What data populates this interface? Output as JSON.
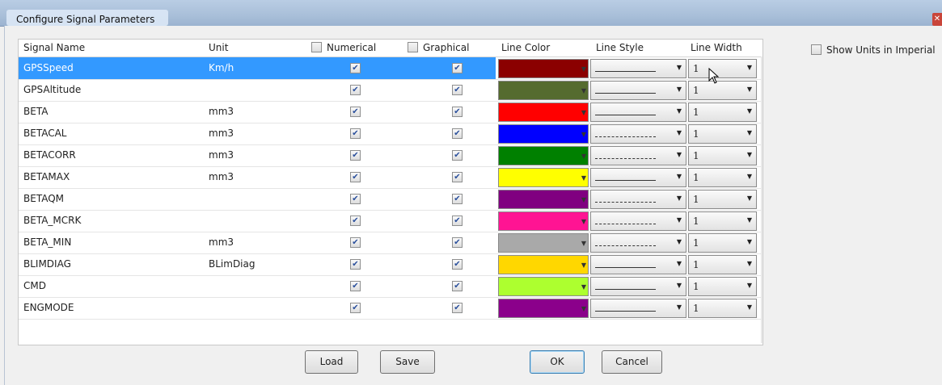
{
  "window": {
    "title": "Configure Signal Parameters",
    "close_icon": "close-icon"
  },
  "grid": {
    "headers": {
      "signal_name": "Signal Name",
      "unit": "Unit",
      "numerical": "Numerical",
      "graphical": "Graphical",
      "line_color": "Line Color",
      "line_style": "Line Style",
      "line_width": "Line Width"
    },
    "rows": [
      {
        "name": "GPSSpeed",
        "unit": "Km/h",
        "numerical": true,
        "graphical": true,
        "color": "#8b0000",
        "style": "solid",
        "width": "1",
        "selected": true
      },
      {
        "name": "GPSAltitude",
        "unit": "",
        "numerical": true,
        "graphical": true,
        "color": "#556b2f",
        "style": "solid",
        "width": "1"
      },
      {
        "name": "BETA",
        "unit": "mm3",
        "numerical": true,
        "graphical": true,
        "color": "#ff0000",
        "style": "solid",
        "width": "1"
      },
      {
        "name": "BETACAL",
        "unit": "mm3",
        "numerical": true,
        "graphical": true,
        "color": "#0000ff",
        "style": "dashed",
        "width": "1"
      },
      {
        "name": "BETACORR",
        "unit": "mm3",
        "numerical": true,
        "graphical": true,
        "color": "#008000",
        "style": "dashed",
        "width": "1"
      },
      {
        "name": "BETAMAX",
        "unit": "mm3",
        "numerical": true,
        "graphical": true,
        "color": "#ffff00",
        "style": "solid",
        "width": "1"
      },
      {
        "name": "BETAQM",
        "unit": "",
        "numerical": true,
        "graphical": true,
        "color": "#800080",
        "style": "dashed",
        "width": "1"
      },
      {
        "name": "BETA_MCRK",
        "unit": "",
        "numerical": true,
        "graphical": true,
        "color": "#ff1493",
        "style": "dashed",
        "width": "1"
      },
      {
        "name": "BETA_MIN",
        "unit": "mm3",
        "numerical": true,
        "graphical": true,
        "color": "#a9a9a9",
        "style": "dashed",
        "width": "1"
      },
      {
        "name": "BLIMDIAG",
        "unit": "BLimDiag",
        "numerical": true,
        "graphical": true,
        "color": "#ffd700",
        "style": "solid",
        "width": "1"
      },
      {
        "name": "CMD",
        "unit": "",
        "numerical": true,
        "graphical": true,
        "color": "#adff2f",
        "style": "solid",
        "width": "1"
      },
      {
        "name": "ENGMODE",
        "unit": "",
        "numerical": true,
        "graphical": true,
        "color": "#8b008b",
        "style": "solid",
        "width": "1"
      }
    ]
  },
  "options": {
    "show_units_imperial": "Show Units in Imperial",
    "show_units_imperial_checked": false
  },
  "buttons": {
    "load": "Load",
    "save": "Save",
    "ok": "OK",
    "cancel": "Cancel"
  },
  "check_mark": "✔"
}
